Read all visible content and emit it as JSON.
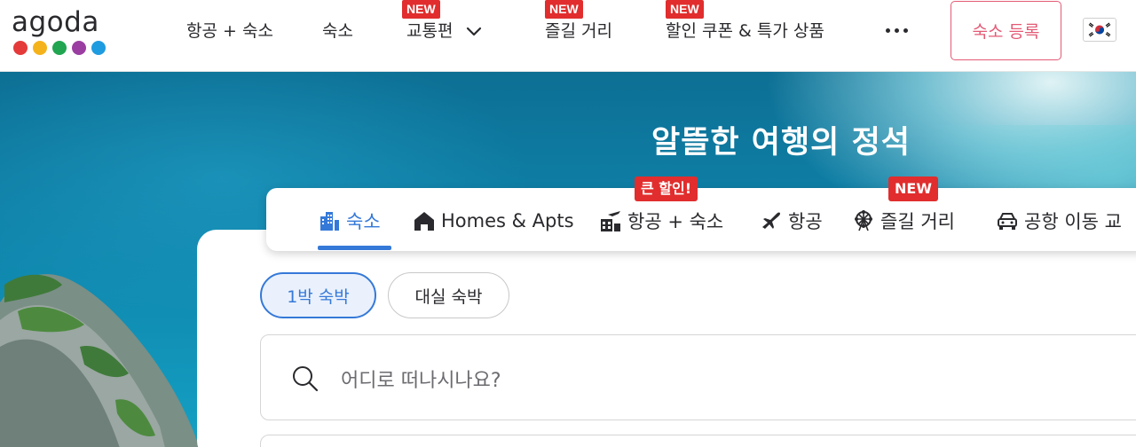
{
  "brand": {
    "name": "agoda",
    "dot_colors": [
      "#e53a3a",
      "#f5b31b",
      "#21a551",
      "#9b3ea2",
      "#1f9be0"
    ]
  },
  "nav": {
    "items": [
      {
        "label": "항공 + 숙소",
        "badge": ""
      },
      {
        "label": "숙소",
        "badge": ""
      },
      {
        "label": "교통편",
        "badge": "NEW"
      },
      {
        "label": "즐길 거리",
        "badge": "NEW"
      },
      {
        "label": "할인 쿠폰 & 특가 상품",
        "badge": "NEW"
      }
    ],
    "more_icon": "ellipsis-icon",
    "register_label": "숙소 등록",
    "locale_flag": "south-korea-flag-icon"
  },
  "hero": {
    "title": "알뜰한 여행의 정석"
  },
  "search_tabs": {
    "items": [
      {
        "label": "숙소",
        "icon": "building-icon",
        "badge": "",
        "active": true
      },
      {
        "label": "Homes & Apts",
        "icon": "house-icon",
        "badge": "",
        "active": false
      },
      {
        "label": "항공 + 숙소",
        "icon": "hotel-plane-icon",
        "badge": "큰 할인!",
        "active": false
      },
      {
        "label": "항공",
        "icon": "airplane-icon",
        "badge": "",
        "active": false
      },
      {
        "label": "즐길 거리",
        "icon": "ferris-wheel-icon",
        "badge": "NEW",
        "active": false
      },
      {
        "label": "공항 이동 교",
        "icon": "car-icon",
        "badge": "",
        "active": false
      }
    ]
  },
  "stay_type": {
    "options": [
      "1박 숙박",
      "대실 숙박"
    ],
    "selected": "1박 숙박"
  },
  "search": {
    "placeholder": "어디로 떠나시나요?"
  },
  "colors": {
    "accent": "#3579d8",
    "badge_red": "#e12d2d",
    "register_pink": "#e35a75"
  }
}
